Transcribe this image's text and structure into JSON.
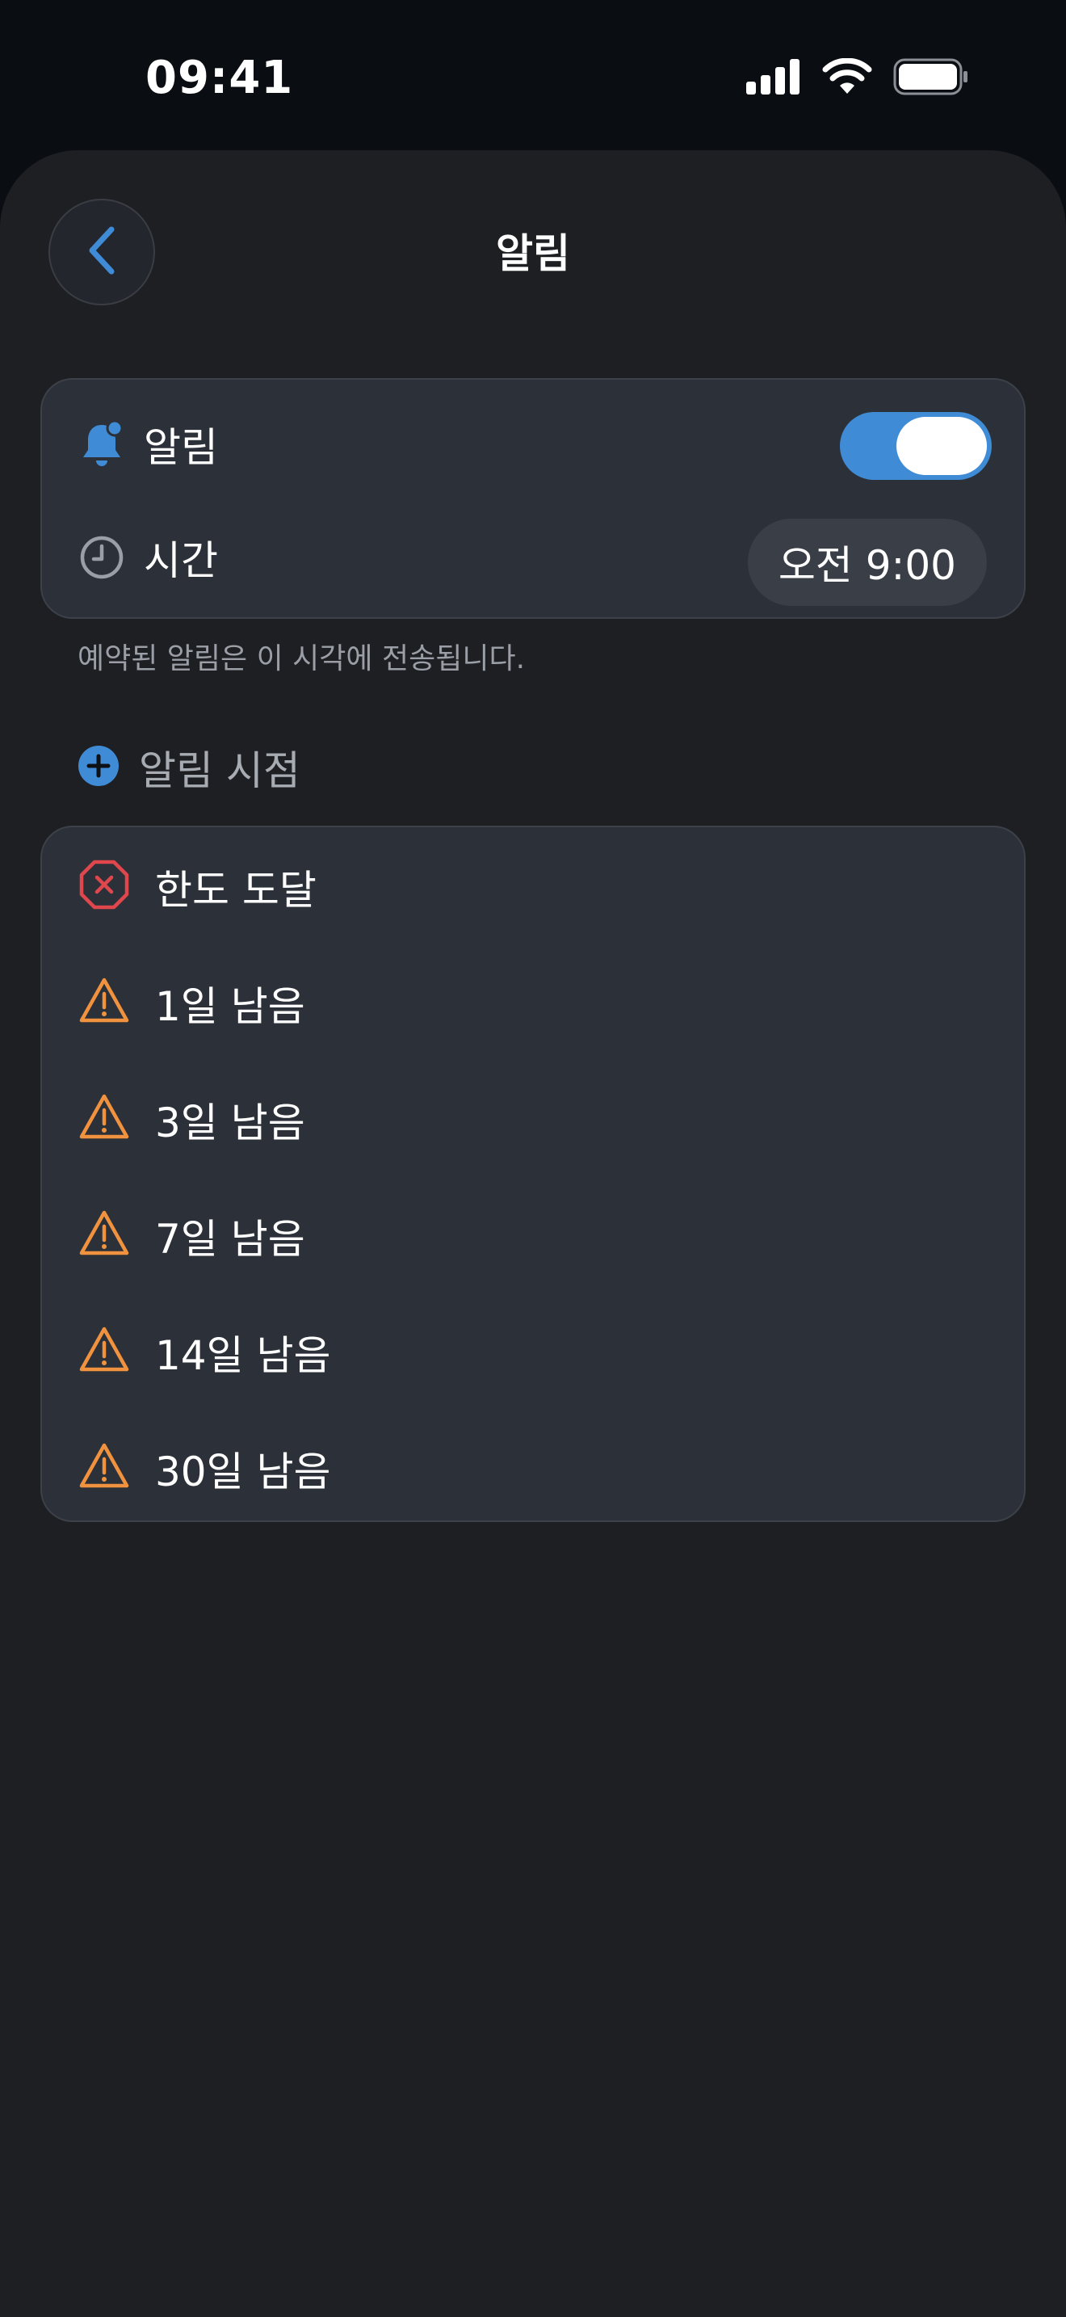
{
  "status_bar": {
    "time": "09:41"
  },
  "header": {
    "title": "알림",
    "back_icon": "chevron-left-icon"
  },
  "alarm_card": {
    "alarm_label": "알림",
    "alarm_enabled": true,
    "time_label": "시간",
    "time_value": "오전 9:00"
  },
  "footnote": "예약된 알림은 이 시각에 전송됩니다.",
  "section": {
    "label": "알림 시점",
    "add_icon": "plus-circle-icon"
  },
  "notification_points": [
    {
      "label": "한도 도달",
      "icon": "x-octagon-icon",
      "color": "#e0474c"
    },
    {
      "label": "1일 남음",
      "icon": "warning-triangle-icon",
      "color": "#f0923e"
    },
    {
      "label": "3일 남음",
      "icon": "warning-triangle-icon",
      "color": "#f0923e"
    },
    {
      "label": "7일 남음",
      "icon": "warning-triangle-icon",
      "color": "#f0923e"
    },
    {
      "label": "14일 남음",
      "icon": "warning-triangle-icon",
      "color": "#f0923e"
    },
    {
      "label": "30일 남음",
      "icon": "warning-triangle-icon",
      "color": "#f0923e"
    }
  ],
  "colors": {
    "accent": "#3f8bd6",
    "danger": "#e0474c",
    "warning": "#f0923e",
    "background": "#1e1f23",
    "card": "#2c3139"
  }
}
